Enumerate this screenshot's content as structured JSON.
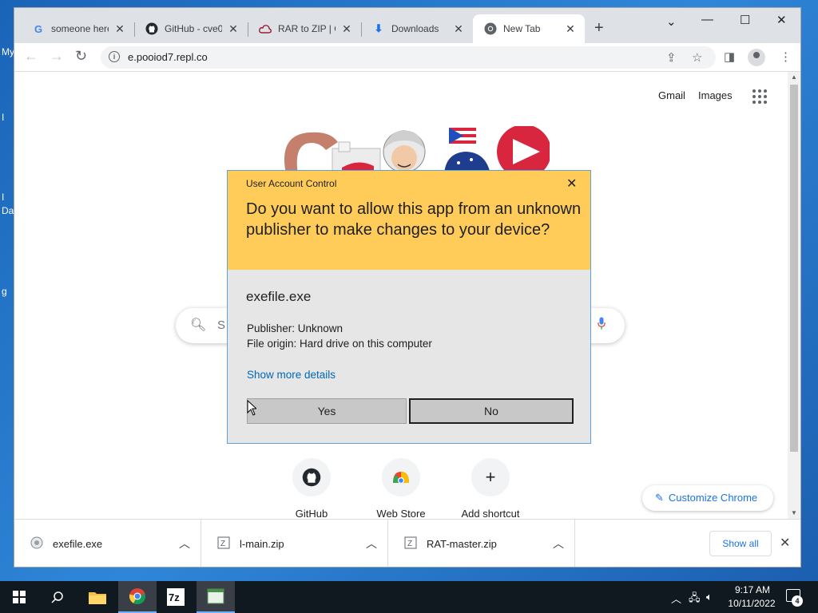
{
  "desktop": {
    "labels": [
      "My",
      "I",
      "I",
      "Da",
      "g"
    ]
  },
  "browser": {
    "tabs": [
      {
        "title": "someone here",
        "icon": "google-icon"
      },
      {
        "title": "GitHub - cve0",
        "icon": "github-icon"
      },
      {
        "title": "RAR to ZIP | C",
        "icon": "cloud-convert-icon"
      },
      {
        "title": "Downloads",
        "icon": "download-icon"
      },
      {
        "title": "New Tab",
        "icon": "chrome-icon",
        "active": true
      }
    ],
    "url": "e.pooiod7.repl.co"
  },
  "newtab": {
    "links": {
      "gmail": "Gmail",
      "images": "Images"
    },
    "search_placeholder": "S",
    "shortcuts": [
      {
        "label": "GitHub",
        "icon": "github-icon"
      },
      {
        "label": "Web Store",
        "icon": "chrome-web-store-icon"
      },
      {
        "label": "Add shortcut",
        "icon": "plus-icon"
      }
    ],
    "customize_label": "Customize Chrome"
  },
  "downloads": {
    "items": [
      {
        "name": "exefile.exe",
        "icon": "exe-file-icon"
      },
      {
        "name": "l-main.zip",
        "icon": "zip-file-icon"
      },
      {
        "name": "RAT-master.zip",
        "icon": "zip-file-icon"
      }
    ],
    "show_all": "Show all"
  },
  "uac": {
    "title": "User Account Control",
    "question": "Do you want to allow this app from an unknown publisher to make changes to your device?",
    "app_name": "exefile.exe",
    "publisher": "Publisher: Unknown",
    "origin": "File origin: Hard drive on this computer",
    "more_details": "Show more details",
    "yes_label": "Yes",
    "no_label": "No",
    "header_color": "#ffcc59"
  },
  "taskbar": {
    "time": "9:17 AM",
    "date": "10/11/2022",
    "notification_count": "4",
    "apps": [
      "file-explorer-icon",
      "chrome-icon",
      "7zip-icon",
      "app-window-icon"
    ]
  }
}
